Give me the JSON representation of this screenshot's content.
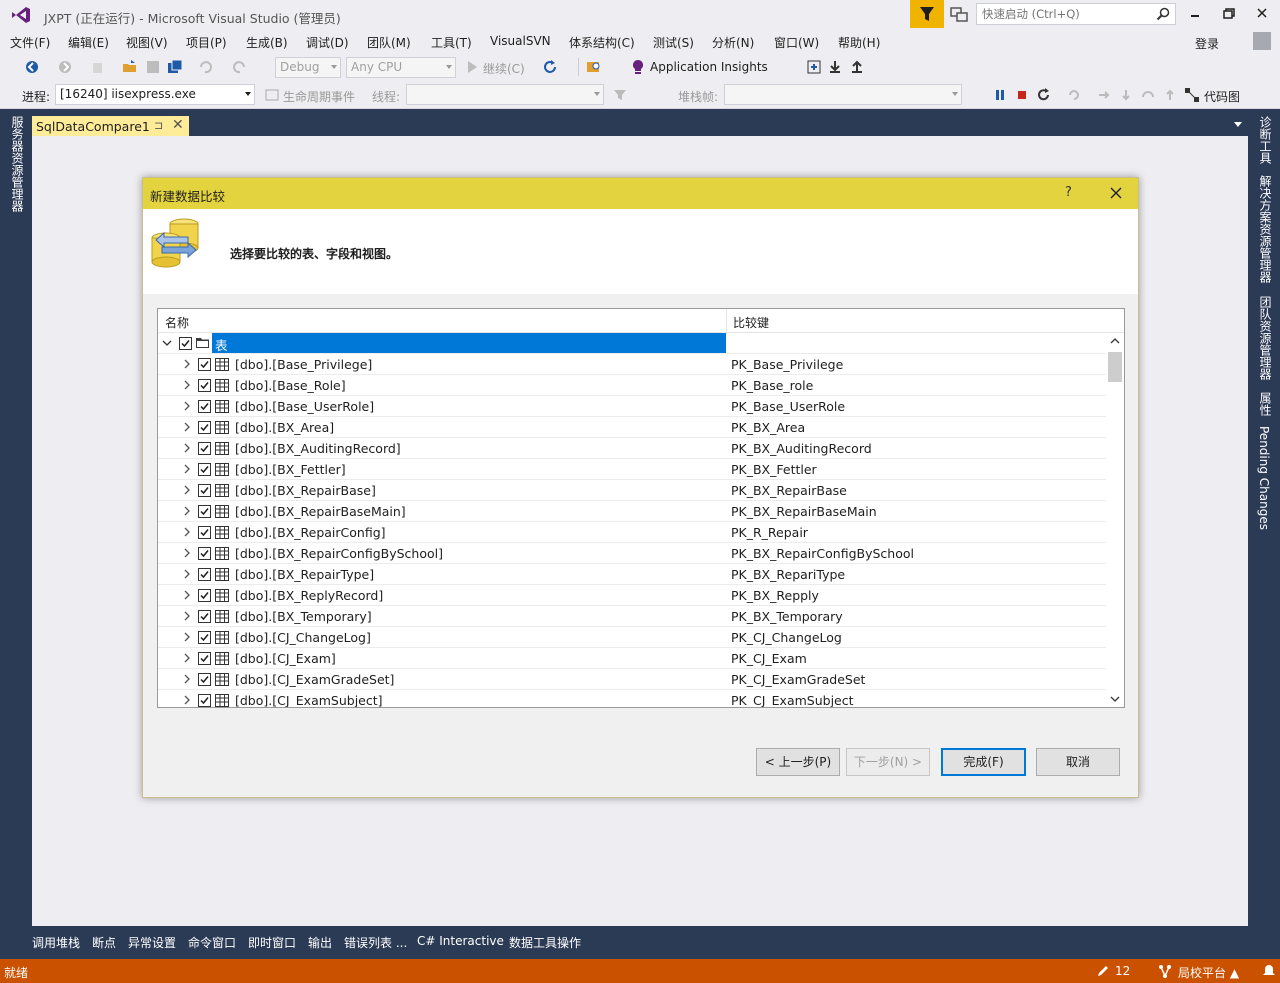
{
  "window": {
    "title": "JXPT (正在运行) - Microsoft Visual Studio (管理员)",
    "quick_launch_placeholder": "快速启动 (Ctrl+Q)",
    "login_label": "登录"
  },
  "menu": [
    "文件(F)",
    "编辑(E)",
    "视图(V)",
    "项目(P)",
    "生成(B)",
    "调试(D)",
    "团队(M)",
    "工具(T)",
    "VisualSVN",
    "体系结构(C)",
    "测试(S)",
    "分析(N)",
    "窗口(W)",
    "帮助(H)"
  ],
  "toolbar": {
    "config": "Debug",
    "platform": "Any CPU",
    "continue_label": "继续(C)",
    "insights_label": "Application Insights",
    "process_label": "进程:",
    "process_value": "[16240] iisexpress.exe",
    "lifecycle_label": "生命周期事件",
    "thread_label": "线程:",
    "stackframe_label": "堆栈帧:",
    "codemap_label": "代码图"
  },
  "left_strip": [
    "服务器资源管理器"
  ],
  "right_strip": [
    "诊断工具",
    "解决方案资源管理器",
    "团队资源管理器",
    "属性",
    "Pending Changes"
  ],
  "document_tab": {
    "title": "SqlDataCompare1",
    "pin": "⊐",
    "close": "✕"
  },
  "dialog": {
    "title": "新建数据比较",
    "help": "?",
    "instruction": "选择要比较的表、字段和视图。",
    "columns": {
      "name": "名称",
      "key": "比较键"
    },
    "root_label": "表",
    "rows": [
      {
        "name": "[dbo].[Base_Privilege]",
        "key": "PK_Base_Privilege"
      },
      {
        "name": "[dbo].[Base_Role]",
        "key": "PK_Base_role"
      },
      {
        "name": "[dbo].[Base_UserRole]",
        "key": "PK_Base_UserRole"
      },
      {
        "name": "[dbo].[BX_Area]",
        "key": "PK_BX_Area"
      },
      {
        "name": "[dbo].[BX_AuditingRecord]",
        "key": "PK_BX_AuditingRecord"
      },
      {
        "name": "[dbo].[BX_Fettler]",
        "key": "PK_BX_Fettler"
      },
      {
        "name": "[dbo].[BX_RepairBase]",
        "key": "PK_BX_RepairBase"
      },
      {
        "name": "[dbo].[BX_RepairBaseMain]",
        "key": "PK_BX_RepairBaseMain"
      },
      {
        "name": "[dbo].[BX_RepairConfig]",
        "key": "PK_R_Repair"
      },
      {
        "name": "[dbo].[BX_RepairConfigBySchool]",
        "key": "PK_BX_RepairConfigBySchool"
      },
      {
        "name": "[dbo].[BX_RepairType]",
        "key": "PK_BX_RepariType"
      },
      {
        "name": "[dbo].[BX_ReplyRecord]",
        "key": "PK_BX_Repply"
      },
      {
        "name": "[dbo].[BX_Temporary]",
        "key": "PK_BX_Temporary"
      },
      {
        "name": "[dbo].[CJ_ChangeLog]",
        "key": "PK_CJ_ChangeLog"
      },
      {
        "name": "[dbo].[CJ_Exam]",
        "key": "PK_CJ_Exam"
      },
      {
        "name": "[dbo].[CJ_ExamGradeSet]",
        "key": "PK_CJ_ExamGradeSet"
      },
      {
        "name": "[dbo].[CJ_ExamSubject]",
        "key": "PK_CJ_ExamSubject"
      }
    ],
    "buttons": {
      "prev": "< 上一步(P)",
      "next": "下一步(N) >",
      "finish": "完成(F)",
      "cancel": "取消"
    }
  },
  "bottom_tabs": [
    "调用堆栈",
    "断点",
    "异常设置",
    "命令窗口",
    "即时窗口",
    "输出",
    "错误列表 ...",
    "C# Interactive",
    "数据工具操作"
  ],
  "status": {
    "text": "就绪",
    "edits": "12",
    "branch": "局校平台 ▲"
  }
}
